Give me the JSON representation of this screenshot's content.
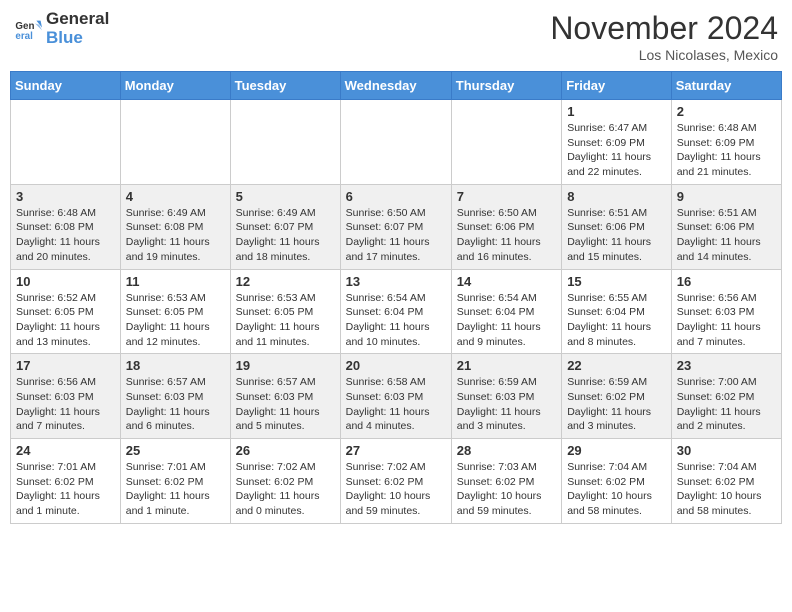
{
  "header": {
    "logo_line1": "General",
    "logo_line2": "Blue",
    "month": "November 2024",
    "location": "Los Nicolases, Mexico"
  },
  "weekdays": [
    "Sunday",
    "Monday",
    "Tuesday",
    "Wednesday",
    "Thursday",
    "Friday",
    "Saturday"
  ],
  "weeks": [
    [
      {
        "day": "",
        "info": ""
      },
      {
        "day": "",
        "info": ""
      },
      {
        "day": "",
        "info": ""
      },
      {
        "day": "",
        "info": ""
      },
      {
        "day": "",
        "info": ""
      },
      {
        "day": "1",
        "info": "Sunrise: 6:47 AM\nSunset: 6:09 PM\nDaylight: 11 hours and 22 minutes."
      },
      {
        "day": "2",
        "info": "Sunrise: 6:48 AM\nSunset: 6:09 PM\nDaylight: 11 hours and 21 minutes."
      }
    ],
    [
      {
        "day": "3",
        "info": "Sunrise: 6:48 AM\nSunset: 6:08 PM\nDaylight: 11 hours and 20 minutes."
      },
      {
        "day": "4",
        "info": "Sunrise: 6:49 AM\nSunset: 6:08 PM\nDaylight: 11 hours and 19 minutes."
      },
      {
        "day": "5",
        "info": "Sunrise: 6:49 AM\nSunset: 6:07 PM\nDaylight: 11 hours and 18 minutes."
      },
      {
        "day": "6",
        "info": "Sunrise: 6:50 AM\nSunset: 6:07 PM\nDaylight: 11 hours and 17 minutes."
      },
      {
        "day": "7",
        "info": "Sunrise: 6:50 AM\nSunset: 6:06 PM\nDaylight: 11 hours and 16 minutes."
      },
      {
        "day": "8",
        "info": "Sunrise: 6:51 AM\nSunset: 6:06 PM\nDaylight: 11 hours and 15 minutes."
      },
      {
        "day": "9",
        "info": "Sunrise: 6:51 AM\nSunset: 6:06 PM\nDaylight: 11 hours and 14 minutes."
      }
    ],
    [
      {
        "day": "10",
        "info": "Sunrise: 6:52 AM\nSunset: 6:05 PM\nDaylight: 11 hours and 13 minutes."
      },
      {
        "day": "11",
        "info": "Sunrise: 6:53 AM\nSunset: 6:05 PM\nDaylight: 11 hours and 12 minutes."
      },
      {
        "day": "12",
        "info": "Sunrise: 6:53 AM\nSunset: 6:05 PM\nDaylight: 11 hours and 11 minutes."
      },
      {
        "day": "13",
        "info": "Sunrise: 6:54 AM\nSunset: 6:04 PM\nDaylight: 11 hours and 10 minutes."
      },
      {
        "day": "14",
        "info": "Sunrise: 6:54 AM\nSunset: 6:04 PM\nDaylight: 11 hours and 9 minutes."
      },
      {
        "day": "15",
        "info": "Sunrise: 6:55 AM\nSunset: 6:04 PM\nDaylight: 11 hours and 8 minutes."
      },
      {
        "day": "16",
        "info": "Sunrise: 6:56 AM\nSunset: 6:03 PM\nDaylight: 11 hours and 7 minutes."
      }
    ],
    [
      {
        "day": "17",
        "info": "Sunrise: 6:56 AM\nSunset: 6:03 PM\nDaylight: 11 hours and 7 minutes."
      },
      {
        "day": "18",
        "info": "Sunrise: 6:57 AM\nSunset: 6:03 PM\nDaylight: 11 hours and 6 minutes."
      },
      {
        "day": "19",
        "info": "Sunrise: 6:57 AM\nSunset: 6:03 PM\nDaylight: 11 hours and 5 minutes."
      },
      {
        "day": "20",
        "info": "Sunrise: 6:58 AM\nSunset: 6:03 PM\nDaylight: 11 hours and 4 minutes."
      },
      {
        "day": "21",
        "info": "Sunrise: 6:59 AM\nSunset: 6:03 PM\nDaylight: 11 hours and 3 minutes."
      },
      {
        "day": "22",
        "info": "Sunrise: 6:59 AM\nSunset: 6:02 PM\nDaylight: 11 hours and 3 minutes."
      },
      {
        "day": "23",
        "info": "Sunrise: 7:00 AM\nSunset: 6:02 PM\nDaylight: 11 hours and 2 minutes."
      }
    ],
    [
      {
        "day": "24",
        "info": "Sunrise: 7:01 AM\nSunset: 6:02 PM\nDaylight: 11 hours and 1 minute."
      },
      {
        "day": "25",
        "info": "Sunrise: 7:01 AM\nSunset: 6:02 PM\nDaylight: 11 hours and 1 minute."
      },
      {
        "day": "26",
        "info": "Sunrise: 7:02 AM\nSunset: 6:02 PM\nDaylight: 11 hours and 0 minutes."
      },
      {
        "day": "27",
        "info": "Sunrise: 7:02 AM\nSunset: 6:02 PM\nDaylight: 10 hours and 59 minutes."
      },
      {
        "day": "28",
        "info": "Sunrise: 7:03 AM\nSunset: 6:02 PM\nDaylight: 10 hours and 59 minutes."
      },
      {
        "day": "29",
        "info": "Sunrise: 7:04 AM\nSunset: 6:02 PM\nDaylight: 10 hours and 58 minutes."
      },
      {
        "day": "30",
        "info": "Sunrise: 7:04 AM\nSunset: 6:02 PM\nDaylight: 10 hours and 58 minutes."
      }
    ]
  ]
}
